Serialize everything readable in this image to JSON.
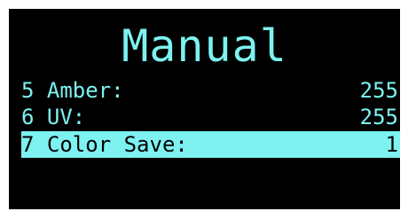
{
  "screen": {
    "title": "Manual",
    "colors": {
      "background": "#000000",
      "text": "#7df2f0",
      "highlight_bg": "#7df2f0",
      "highlight_text": "#000000"
    }
  },
  "menu": {
    "items": [
      {
        "label": "5 Amber:",
        "value": "255",
        "selected": false
      },
      {
        "label": "6 UV:",
        "value": "255",
        "selected": false
      },
      {
        "label": "7 Color Save:",
        "value": "1",
        "selected": true
      }
    ]
  }
}
